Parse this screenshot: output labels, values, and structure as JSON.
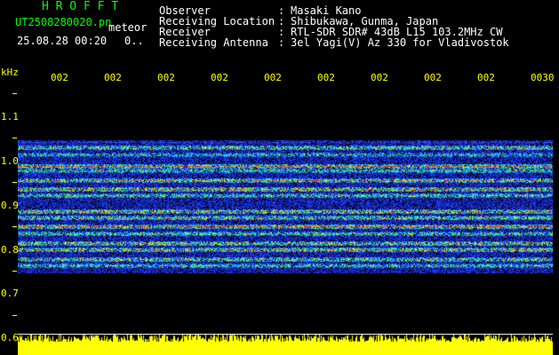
{
  "header": {
    "app_name": "H R O F F T",
    "file_name": "UT2508280020.pn",
    "mode": "meteor",
    "datetime": "25.08.28 00:20",
    "count": "0..",
    "info": [
      {
        "label": "Observer",
        "value": "Masaki Kano"
      },
      {
        "label": "Receiving Location",
        "value": "Shibukawa, Gunma, Japan"
      },
      {
        "label": "Receiver",
        "value": "RTL-SDR SDR# 43dB L15 103.2MHz CW"
      },
      {
        "label": "Receiving Antenna",
        "value": "3el Yagi(V) Az 330 for Vladivostok"
      }
    ]
  },
  "axis": {
    "unit": "kHz",
    "freq_labels": [
      "1.1",
      "1.0",
      "0.9",
      "0.8",
      "0.7",
      "0.6"
    ],
    "time_labels": [
      "002",
      "002",
      "002",
      "002",
      "002",
      "002",
      "002",
      "002",
      "002",
      "0030"
    ]
  },
  "colors": {
    "label_yellow": "#ffff00",
    "title_green": "#00ff00",
    "info_white": "#ffffff",
    "background": "#000000"
  }
}
